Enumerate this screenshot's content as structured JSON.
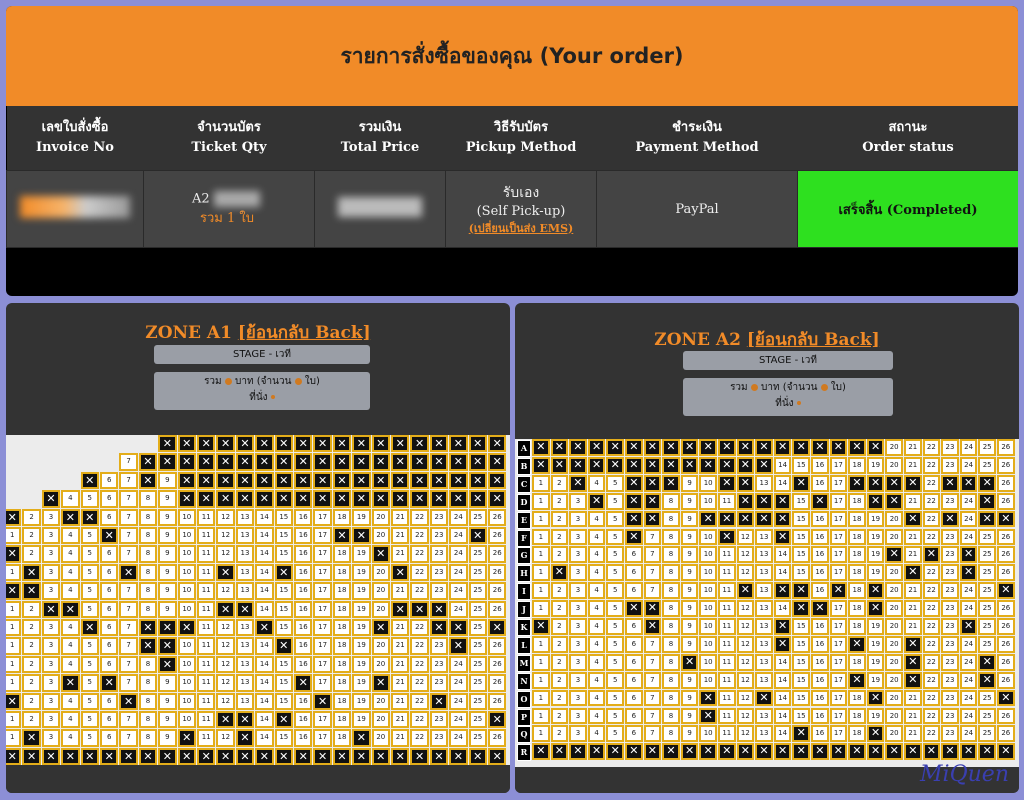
{
  "order": {
    "header_title": "รายการสั่งซื้อของคุณ (Your order)",
    "columns": [
      {
        "th": "เลขใบสั่งซื้อ",
        "en": "Invoice No"
      },
      {
        "th": "จำนวนบัตร",
        "en": "Ticket Qty"
      },
      {
        "th": "รวมเงิน",
        "en": "Total Price"
      },
      {
        "th": "วิธีรับบัตร",
        "en": "Pickup Method"
      },
      {
        "th": "ชำระเงิน",
        "en": "Payment Method"
      },
      {
        "th": "สถานะ",
        "en": "Order status"
      }
    ],
    "ticket_zone": "A2",
    "ticket_total": "รวม 1 ใบ",
    "pickup_th": "รับเอง",
    "pickup_en": "(Self Pick-up)",
    "pickup_change_link": "(เปลี่ยนเป็นส่ง EMS)",
    "payment": "PayPal",
    "status": "เสร็จสิ้น (Completed)",
    "colors": {
      "header": "#f18b28",
      "completed": "#2ee01f"
    }
  },
  "zones": [
    {
      "zone_label": "ZONE A1",
      "back_link": "[ย้อนกลับ Back]",
      "stage": "STAGE - เวที",
      "summary_line1": "รวม",
      "summary_baht": "บาท (จำนวน",
      "summary_unit": "ใบ)",
      "summary_line2": "ที่นั่ง"
    },
    {
      "zone_label": "ZONE A2",
      "back_link": "[ย้อนกลับ Back]",
      "stage": "STAGE - เวที",
      "summary_line1": "รวม",
      "summary_baht": "บาท (จำนวน",
      "summary_unit": "ใบ)",
      "summary_line2": "ที่นั่ง",
      "row_labels": [
        "A",
        "B",
        "C",
        "D",
        "E",
        "F",
        "G",
        "H",
        "I",
        "J",
        "K",
        "L",
        "M",
        "N",
        "O",
        "P",
        "Q",
        "R"
      ]
    }
  ],
  "watermark": "MiQuen"
}
